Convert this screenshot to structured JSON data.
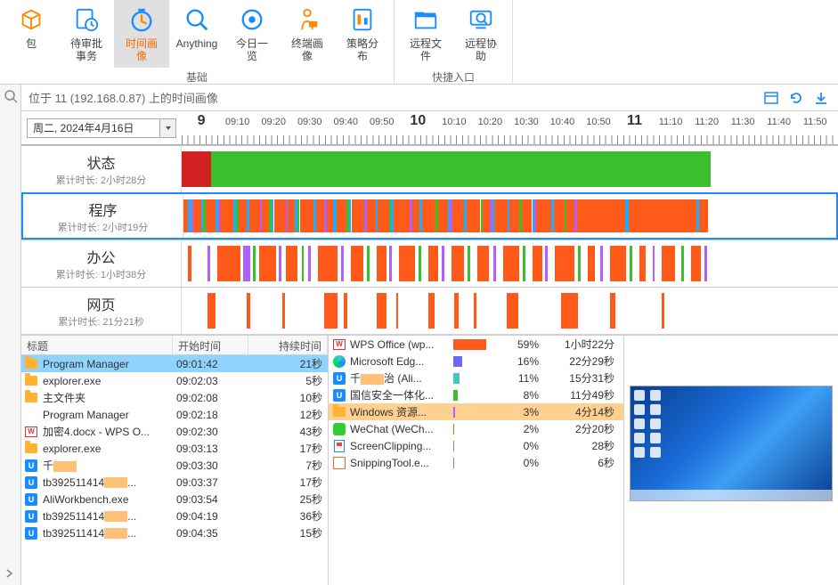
{
  "ribbon": {
    "groups": [
      {
        "label": "基础",
        "items": [
          {
            "id": "pkg",
            "label": "包",
            "color": "#ff8a00"
          },
          {
            "id": "approve",
            "label": "待审批事务",
            "color": "#1a8cff"
          },
          {
            "id": "timeimg",
            "label": "时间画像",
            "color": "#1a8cff",
            "selected": true
          },
          {
            "id": "anything",
            "label": "Anything",
            "color": "#1a8cff"
          },
          {
            "id": "today",
            "label": "今日一览",
            "color": "#1a8cff"
          },
          {
            "id": "terminal",
            "label": "终端画像",
            "color": "#ff8a00"
          },
          {
            "id": "policy",
            "label": "策略分布",
            "color": "#1a8cff"
          }
        ]
      },
      {
        "label": "快捷入口",
        "items": [
          {
            "id": "remotefile",
            "label": "远程文件",
            "color": "#1a8cff"
          },
          {
            "id": "remoteassist",
            "label": "远程协助",
            "color": "#1a8cff"
          }
        ]
      }
    ]
  },
  "location": {
    "text": "位于 11 (192.168.0.87) 上的时间画像"
  },
  "datePicker": {
    "value": "周二, 2024年4月16日"
  },
  "ruler": {
    "majors": [
      {
        "label": "9",
        "pct": 3
      },
      {
        "label": "10",
        "pct": 36
      },
      {
        "label": "11",
        "pct": 69
      }
    ],
    "minors": [
      {
        "label": "09:10",
        "pct": 8.5
      },
      {
        "label": "09:20",
        "pct": 14
      },
      {
        "label": "09:30",
        "pct": 19.5
      },
      {
        "label": "09:40",
        "pct": 25
      },
      {
        "label": "09:50",
        "pct": 30.5
      },
      {
        "label": "10:10",
        "pct": 41.5
      },
      {
        "label": "10:20",
        "pct": 47
      },
      {
        "label": "10:30",
        "pct": 52.5
      },
      {
        "label": "10:40",
        "pct": 58
      },
      {
        "label": "10:50",
        "pct": 63.5
      },
      {
        "label": "11:10",
        "pct": 74.5
      },
      {
        "label": "11:20",
        "pct": 80
      },
      {
        "label": "11:30",
        "pct": 85.5
      },
      {
        "label": "11:40",
        "pct": 91
      },
      {
        "label": "11:50",
        "pct": 96.5
      }
    ]
  },
  "categories": [
    {
      "id": "status",
      "title": "状态",
      "sub": "累计时长: 2小时28分",
      "selected": false,
      "segments": [
        {
          "l": 0,
          "w": 4.5,
          "c": "#d32020"
        },
        {
          "l": 4.5,
          "w": 77,
          "c": "#3cbf2e"
        }
      ]
    },
    {
      "id": "programs",
      "title": "程序",
      "sub": "累计时长: 2小时19分",
      "selected": true,
      "segments": [
        {
          "l": 0,
          "w": 0.7,
          "c": "#ff5a1a"
        },
        {
          "l": 0.7,
          "w": 0.5,
          "c": "#1ab0ff"
        },
        {
          "l": 1.2,
          "w": 0.3,
          "c": "#b060ff"
        },
        {
          "l": 1.5,
          "w": 1.2,
          "c": "#ff5a1a"
        },
        {
          "l": 2.7,
          "w": 0.4,
          "c": "#1ab0ff"
        },
        {
          "l": 3.1,
          "w": 0.3,
          "c": "#3cbf2e"
        },
        {
          "l": 3.4,
          "w": 1.6,
          "c": "#ff5a1a"
        },
        {
          "l": 5.0,
          "w": 0.4,
          "c": "#1ab0ff"
        },
        {
          "l": 5.4,
          "w": 0.3,
          "c": "#b060ff"
        },
        {
          "l": 5.7,
          "w": 2.0,
          "c": "#ff5a1a"
        },
        {
          "l": 7.7,
          "w": 0.5,
          "c": "#1ab0ff"
        },
        {
          "l": 8.2,
          "w": 0.3,
          "c": "#3cbf2e"
        },
        {
          "l": 8.5,
          "w": 1.3,
          "c": "#ff5a1a"
        },
        {
          "l": 9.8,
          "w": 0.4,
          "c": "#1ab0ff"
        },
        {
          "l": 10.2,
          "w": 1.6,
          "c": "#ff5a1a"
        },
        {
          "l": 11.8,
          "w": 0.3,
          "c": "#b060ff"
        },
        {
          "l": 12.1,
          "w": 1.1,
          "c": "#ff5a1a"
        },
        {
          "l": 13.2,
          "w": 0.4,
          "c": "#3cbf2e"
        },
        {
          "l": 13.6,
          "w": 0.4,
          "c": "#1ab0ff"
        },
        {
          "l": 14.0,
          "w": 1.8,
          "c": "#ff5a1a"
        },
        {
          "l": 15.8,
          "w": 0.3,
          "c": "#b060ff"
        },
        {
          "l": 16.1,
          "w": 1.2,
          "c": "#ff5a1a"
        },
        {
          "l": 17.3,
          "w": 0.4,
          "c": "#1ab0ff"
        },
        {
          "l": 17.7,
          "w": 0.3,
          "c": "#3cbf2e"
        },
        {
          "l": 18.0,
          "w": 2.2,
          "c": "#ff5a1a"
        },
        {
          "l": 20.2,
          "w": 0.3,
          "c": "#1ab0ff"
        },
        {
          "l": 20.5,
          "w": 1.3,
          "c": "#ff5a1a"
        },
        {
          "l": 21.8,
          "w": 0.4,
          "c": "#b060ff"
        },
        {
          "l": 22.2,
          "w": 1.0,
          "c": "#ff5a1a"
        },
        {
          "l": 23.2,
          "w": 0.5,
          "c": "#1ab0ff"
        },
        {
          "l": 23.7,
          "w": 1.6,
          "c": "#ff5a1a"
        },
        {
          "l": 25.3,
          "w": 0.4,
          "c": "#3cbf2e"
        },
        {
          "l": 25.7,
          "w": 0.3,
          "c": "#1ab0ff"
        },
        {
          "l": 26.0,
          "w": 2.0,
          "c": "#ff5a1a"
        },
        {
          "l": 28.0,
          "w": 0.4,
          "c": "#b060ff"
        },
        {
          "l": 28.4,
          "w": 1.4,
          "c": "#ff5a1a"
        },
        {
          "l": 29.8,
          "w": 0.3,
          "c": "#1ab0ff"
        },
        {
          "l": 30.1,
          "w": 1.7,
          "c": "#ff5a1a"
        },
        {
          "l": 31.8,
          "w": 0.4,
          "c": "#3cbf2e"
        },
        {
          "l": 32.2,
          "w": 0.3,
          "c": "#1ab0ff"
        },
        {
          "l": 32.5,
          "w": 2.5,
          "c": "#ff5a1a"
        },
        {
          "l": 35.0,
          "w": 0.4,
          "c": "#b060ff"
        },
        {
          "l": 35.4,
          "w": 1.2,
          "c": "#ff5a1a"
        },
        {
          "l": 36.6,
          "w": 0.3,
          "c": "#1ab0ff"
        },
        {
          "l": 36.9,
          "w": 2.1,
          "c": "#ff5a1a"
        },
        {
          "l": 39.0,
          "w": 0.4,
          "c": "#3cbf2e"
        },
        {
          "l": 39.4,
          "w": 1.6,
          "c": "#ff5a1a"
        },
        {
          "l": 41.0,
          "w": 0.3,
          "c": "#1ab0ff"
        },
        {
          "l": 41.3,
          "w": 0.3,
          "c": "#b060ff"
        },
        {
          "l": 41.6,
          "w": 1.8,
          "c": "#ff5a1a"
        },
        {
          "l": 43.4,
          "w": 0.4,
          "c": "#1ab0ff"
        },
        {
          "l": 43.8,
          "w": 2.2,
          "c": "#ff5a1a"
        },
        {
          "l": 46.0,
          "w": 0.3,
          "c": "#3cbf2e"
        },
        {
          "l": 46.3,
          "w": 1.2,
          "c": "#ff5a1a"
        },
        {
          "l": 47.5,
          "w": 0.4,
          "c": "#b060ff"
        },
        {
          "l": 47.9,
          "w": 0.3,
          "c": "#1ab0ff"
        },
        {
          "l": 48.2,
          "w": 2.0,
          "c": "#ff5a1a"
        },
        {
          "l": 50.2,
          "w": 0.3,
          "c": "#1ab0ff"
        },
        {
          "l": 50.5,
          "w": 1.5,
          "c": "#ff5a1a"
        },
        {
          "l": 52.0,
          "w": 0.4,
          "c": "#3cbf2e"
        },
        {
          "l": 52.4,
          "w": 1.6,
          "c": "#ff5a1a"
        },
        {
          "l": 54.0,
          "w": 0.3,
          "c": "#1ab0ff"
        },
        {
          "l": 54.3,
          "w": 0.3,
          "c": "#b060ff"
        },
        {
          "l": 54.6,
          "w": 2.4,
          "c": "#ff5a1a"
        },
        {
          "l": 57.0,
          "w": 0.4,
          "c": "#1ab0ff"
        },
        {
          "l": 57.4,
          "w": 1.6,
          "c": "#ff5a1a"
        },
        {
          "l": 59.0,
          "w": 0.3,
          "c": "#3cbf2e"
        },
        {
          "l": 59.3,
          "w": 1.2,
          "c": "#ff5a1a"
        },
        {
          "l": 60.5,
          "w": 0.4,
          "c": "#b060ff"
        },
        {
          "l": 60.9,
          "w": 7.5,
          "c": "#ff5a1a"
        },
        {
          "l": 68.4,
          "w": 0.6,
          "c": "#1ab0ff"
        },
        {
          "l": 69.0,
          "w": 10.5,
          "c": "#ff5a1a"
        },
        {
          "l": 79.5,
          "w": 0.3,
          "c": "#1ab0ff"
        },
        {
          "l": 79.8,
          "w": 1.5,
          "c": "#ff5a1a"
        }
      ]
    },
    {
      "id": "office",
      "title": "办公",
      "sub": "累计时长: 1小时38分",
      "selected": false,
      "segments": [
        {
          "l": 1.0,
          "w": 0.5,
          "c": "#ff5a1a"
        },
        {
          "l": 4.0,
          "w": 0.4,
          "c": "#b060ff"
        },
        {
          "l": 5.5,
          "w": 3.5,
          "c": "#ff5a1a"
        },
        {
          "l": 9.5,
          "w": 1.0,
          "c": "#b060ff"
        },
        {
          "l": 11.0,
          "w": 0.4,
          "c": "#3cbf2e"
        },
        {
          "l": 12.0,
          "w": 2.5,
          "c": "#ff5a1a"
        },
        {
          "l": 15.0,
          "w": 0.4,
          "c": "#b060ff"
        },
        {
          "l": 16.0,
          "w": 1.8,
          "c": "#ff5a1a"
        },
        {
          "l": 18.5,
          "w": 0.3,
          "c": "#3cbf2e"
        },
        {
          "l": 19.5,
          "w": 0.4,
          "c": "#b060ff"
        },
        {
          "l": 21.0,
          "w": 3.0,
          "c": "#ff5a1a"
        },
        {
          "l": 24.5,
          "w": 0.4,
          "c": "#b060ff"
        },
        {
          "l": 26.0,
          "w": 2.0,
          "c": "#ff5a1a"
        },
        {
          "l": 28.5,
          "w": 0.4,
          "c": "#3cbf2e"
        },
        {
          "l": 30.0,
          "w": 1.5,
          "c": "#ff5a1a"
        },
        {
          "l": 32.0,
          "w": 0.4,
          "c": "#b060ff"
        },
        {
          "l": 33.5,
          "w": 2.5,
          "c": "#ff5a1a"
        },
        {
          "l": 36.5,
          "w": 0.4,
          "c": "#3cbf2e"
        },
        {
          "l": 38.0,
          "w": 1.5,
          "c": "#ff5a1a"
        },
        {
          "l": 40.0,
          "w": 0.4,
          "c": "#b060ff"
        },
        {
          "l": 41.5,
          "w": 2.0,
          "c": "#ff5a1a"
        },
        {
          "l": 44.0,
          "w": 0.4,
          "c": "#3cbf2e"
        },
        {
          "l": 45.5,
          "w": 1.8,
          "c": "#ff5a1a"
        },
        {
          "l": 48.0,
          "w": 0.4,
          "c": "#b060ff"
        },
        {
          "l": 49.5,
          "w": 2.5,
          "c": "#ff5a1a"
        },
        {
          "l": 52.5,
          "w": 0.4,
          "c": "#3cbf2e"
        },
        {
          "l": 54.0,
          "w": 1.5,
          "c": "#ff5a1a"
        },
        {
          "l": 56.0,
          "w": 0.4,
          "c": "#b060ff"
        },
        {
          "l": 57.5,
          "w": 3.0,
          "c": "#ff5a1a"
        },
        {
          "l": 61.0,
          "w": 0.4,
          "c": "#3cbf2e"
        },
        {
          "l": 62.5,
          "w": 1.2,
          "c": "#ff5a1a"
        },
        {
          "l": 64.5,
          "w": 0.4,
          "c": "#b060ff"
        },
        {
          "l": 66.0,
          "w": 2.5,
          "c": "#ff5a1a"
        },
        {
          "l": 69.0,
          "w": 0.4,
          "c": "#3cbf2e"
        },
        {
          "l": 70.5,
          "w": 1.0,
          "c": "#ff5a1a"
        },
        {
          "l": 72.5,
          "w": 0.4,
          "c": "#b060ff"
        },
        {
          "l": 74.0,
          "w": 2.0,
          "c": "#ff5a1a"
        },
        {
          "l": 77.0,
          "w": 0.4,
          "c": "#3cbf2e"
        },
        {
          "l": 78.5,
          "w": 1.5,
          "c": "#ff5a1a"
        },
        {
          "l": 80.5,
          "w": 0.4,
          "c": "#b060ff"
        }
      ]
    },
    {
      "id": "web",
      "title": "网页",
      "sub": "累计时长: 21分21秒",
      "selected": false,
      "segments": [
        {
          "l": 4.0,
          "w": 1.2,
          "c": "#ff5a1a"
        },
        {
          "l": 10.0,
          "w": 0.5,
          "c": "#ff5a1a"
        },
        {
          "l": 15.5,
          "w": 0.4,
          "c": "#ff5a1a"
        },
        {
          "l": 22.0,
          "w": 2.0,
          "c": "#ff5a1a"
        },
        {
          "l": 25.0,
          "w": 0.5,
          "c": "#ff5a1a"
        },
        {
          "l": 30.0,
          "w": 1.5,
          "c": "#ff5a1a"
        },
        {
          "l": 33.0,
          "w": 0.4,
          "c": "#ff5a1a"
        },
        {
          "l": 38.0,
          "w": 1.0,
          "c": "#ff5a1a"
        },
        {
          "l": 42.0,
          "w": 0.6,
          "c": "#ff5a1a"
        },
        {
          "l": 45.0,
          "w": 0.4,
          "c": "#ff5a1a"
        },
        {
          "l": 50.0,
          "w": 1.8,
          "c": "#ff5a1a"
        },
        {
          "l": 58.5,
          "w": 2.5,
          "c": "#ff5a1a"
        },
        {
          "l": 66.0,
          "w": 0.8,
          "c": "#ff5a1a"
        },
        {
          "l": 74.0,
          "w": 0.4,
          "c": "#ff5a1a"
        }
      ]
    }
  ],
  "titleTable": {
    "headers": {
      "title": "标题",
      "start": "开始时间",
      "duration": "持续时间"
    },
    "rows": [
      {
        "icon": "folder",
        "title": "Program Manager",
        "start": "09:01:42",
        "dur": "21秒",
        "selected": true
      },
      {
        "icon": "folder",
        "title": "explorer.exe",
        "start": "09:02:03",
        "dur": "5秒"
      },
      {
        "icon": "folder",
        "title": "主文件夹",
        "start": "09:02:08",
        "dur": "10秒"
      },
      {
        "icon": "none",
        "title": "Program Manager",
        "start": "09:02:18",
        "dur": "12秒"
      },
      {
        "icon": "wps",
        "title": "加密4.docx - WPS O...",
        "start": "09:02:30",
        "dur": "43秒"
      },
      {
        "icon": "folder",
        "title": "explorer.exe",
        "start": "09:03:13",
        "dur": "17秒"
      },
      {
        "icon": "blue-u",
        "title": "千▇▇",
        "start": "09:03:30",
        "dur": "7秒"
      },
      {
        "icon": "blue-u",
        "title": "tb392511414▇▇...",
        "start": "09:03:37",
        "dur": "17秒"
      },
      {
        "icon": "blue-u",
        "title": "AliWorkbench.exe",
        "start": "09:03:54",
        "dur": "25秒"
      },
      {
        "icon": "blue-u",
        "title": "tb392511414▇▇...",
        "start": "09:04:19",
        "dur": "36秒"
      },
      {
        "icon": "blue-u",
        "title": "tb392511414▇▇...",
        "start": "09:04:35",
        "dur": "15秒"
      }
    ]
  },
  "appTable": {
    "rows": [
      {
        "icon": "wps",
        "name": "WPS Office (wp...",
        "pct": "59%",
        "dur": "1小时22分",
        "fill": 59,
        "color": "#ff5a1a"
      },
      {
        "icon": "edge",
        "name": "Microsoft Edg...",
        "pct": "16%",
        "dur": "22分29秒",
        "fill": 16,
        "color": "#6a6aff"
      },
      {
        "icon": "blue-u",
        "name": "千▇▇治 (Ali...",
        "pct": "11%",
        "dur": "15分31秒",
        "fill": 11,
        "color": "#40c8c0"
      },
      {
        "icon": "blue-u",
        "name": "国信安全一体化...",
        "pct": "8%",
        "dur": "11分49秒",
        "fill": 8,
        "color": "#3cbf2e"
      },
      {
        "icon": "folder",
        "name": "Windows 资源...",
        "pct": "3%",
        "dur": "4分14秒",
        "fill": 3,
        "color": "#b060ff",
        "selected": true
      },
      {
        "icon": "wechat",
        "name": "WeChat (WeCh...",
        "pct": "2%",
        "dur": "2分20秒",
        "fill": 2,
        "color": "#ff5a1a"
      },
      {
        "icon": "clip",
        "name": "ScreenClipping...",
        "pct": "0%",
        "dur": "28秒",
        "fill": 1,
        "color": "#888"
      },
      {
        "icon": "snip",
        "name": "SnippingTool.e...",
        "pct": "0%",
        "dur": "6秒",
        "fill": 1,
        "color": "#888"
      }
    ]
  }
}
